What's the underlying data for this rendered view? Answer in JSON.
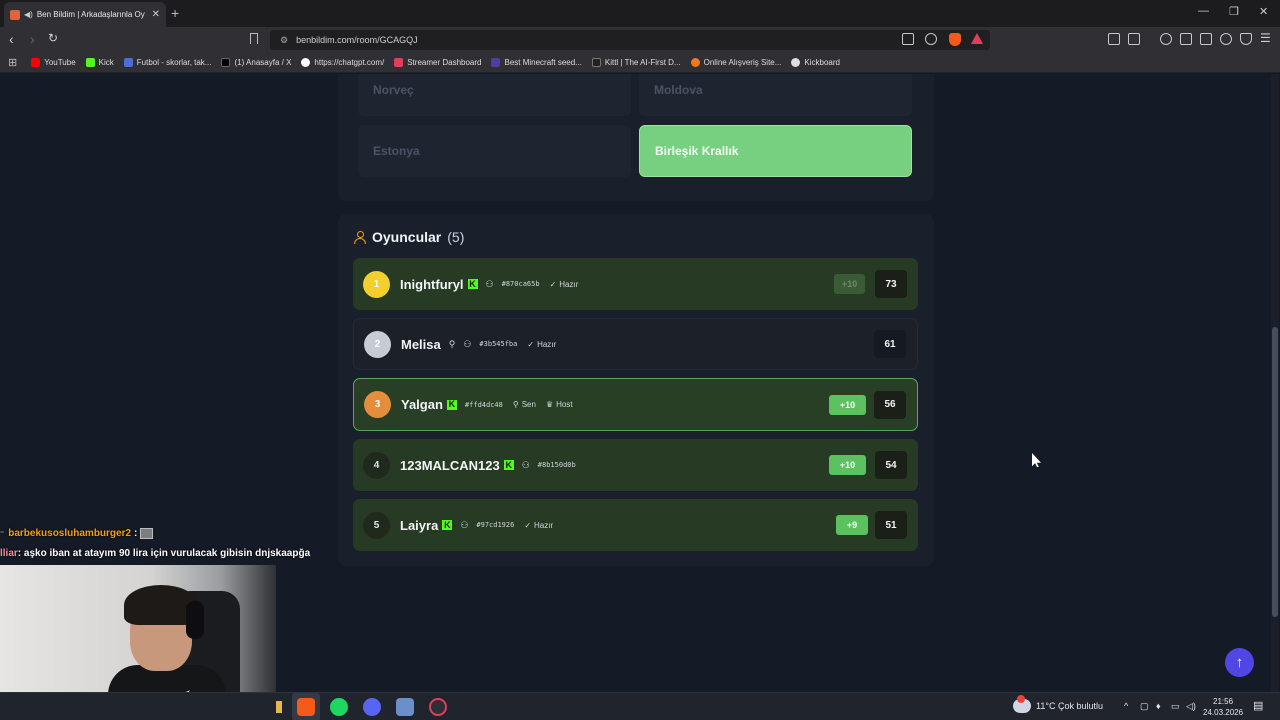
{
  "browser": {
    "tab_title": "Ben Bildim | Arkadaşlarınla Oy",
    "url": "benbildim.com/room/GCAGQJ",
    "new_tab": "+",
    "bookmarks": [
      {
        "label": "YouTube",
        "color": "#ff0000"
      },
      {
        "label": "Kick",
        "color": "#53fc18"
      },
      {
        "label": "Futbol - skorlar, tak...",
        "color": "#4f6bd8"
      },
      {
        "label": "(1) Anasayfa / X",
        "color": "#000000"
      },
      {
        "label": "https://chatgpt.com/",
        "color": "#ffffff"
      },
      {
        "label": "Streamer Dashboard",
        "color": "#e33c5c"
      },
      {
        "label": "Best Minecraft seed...",
        "color": "#4b3fa6"
      },
      {
        "label": "Kittl | The AI-First D...",
        "color": "#222222"
      },
      {
        "label": "Online Alışveriş Site...",
        "color": "#f27a1a"
      },
      {
        "label": "Kickboard",
        "color": "#dddddd"
      }
    ]
  },
  "answers": {
    "options": [
      "Norveç",
      "Moldova",
      "Estonya",
      "Birleşik Krallık"
    ],
    "correct": "Birleşik Krallık"
  },
  "players": {
    "title": "Oyuncular",
    "count": "(5)",
    "rows": [
      {
        "rank": "1",
        "name": "Inightfuryl",
        "kick": "K",
        "hash": "#870ca65b",
        "tags": [
          "Hazır"
        ],
        "bonus": "+10",
        "score": "73"
      },
      {
        "rank": "2",
        "name": "Melisa",
        "hash": "#3b545fba",
        "tags": [
          "Hazır"
        ],
        "bonus": "",
        "score": "61"
      },
      {
        "rank": "3",
        "name": "Yalgan",
        "kick": "K",
        "hash": "#ffd4dc48",
        "tags": [
          "Sen",
          "Host"
        ],
        "bonus": "+10",
        "score": "56"
      },
      {
        "rank": "4",
        "name": "123MALCAN123",
        "kick": "K",
        "hash": "#8b150d0b",
        "tags": [],
        "bonus": "+10",
        "score": "54"
      },
      {
        "rank": "5",
        "name": "Laiyra",
        "kick": "K",
        "hash": "#97cd1926",
        "tags": [
          "Hazır"
        ],
        "bonus": "+9",
        "score": "51"
      }
    ]
  },
  "scroll_top_icon": "arrow-up-icon",
  "stream": {
    "chat1_user": "barbekusosluhamburger2",
    "chat1_colon": ":",
    "chat2_user": "lliar",
    "chat2_text": ": aşko iban at atayım 90 lira için vurulacak gibisin dnjskaapğa"
  },
  "taskbar": {
    "weather": "11°C  Çok bulutlu",
    "time": "21:56",
    "date": "24.03.2026"
  }
}
